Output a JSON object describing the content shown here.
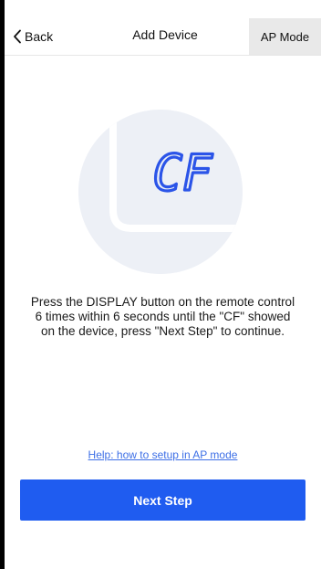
{
  "header": {
    "back_label": "Back",
    "title": "Add Device",
    "mode_button": "AP Mode"
  },
  "illustration": {
    "display_text": "CF",
    "display_color": "#2b54e8",
    "circle_color": "#edf0f6"
  },
  "instructions": "Press the DISPLAY button on the remote control 6 times within 6 seconds until the \"CF\" showed on the device, press \"Next Step\" to continue.",
  "help_link": "Help: how to setup in AP mode",
  "next_button": "Next Step",
  "colors": {
    "accent": "#1f5cf0",
    "link": "#3d6fe6"
  }
}
